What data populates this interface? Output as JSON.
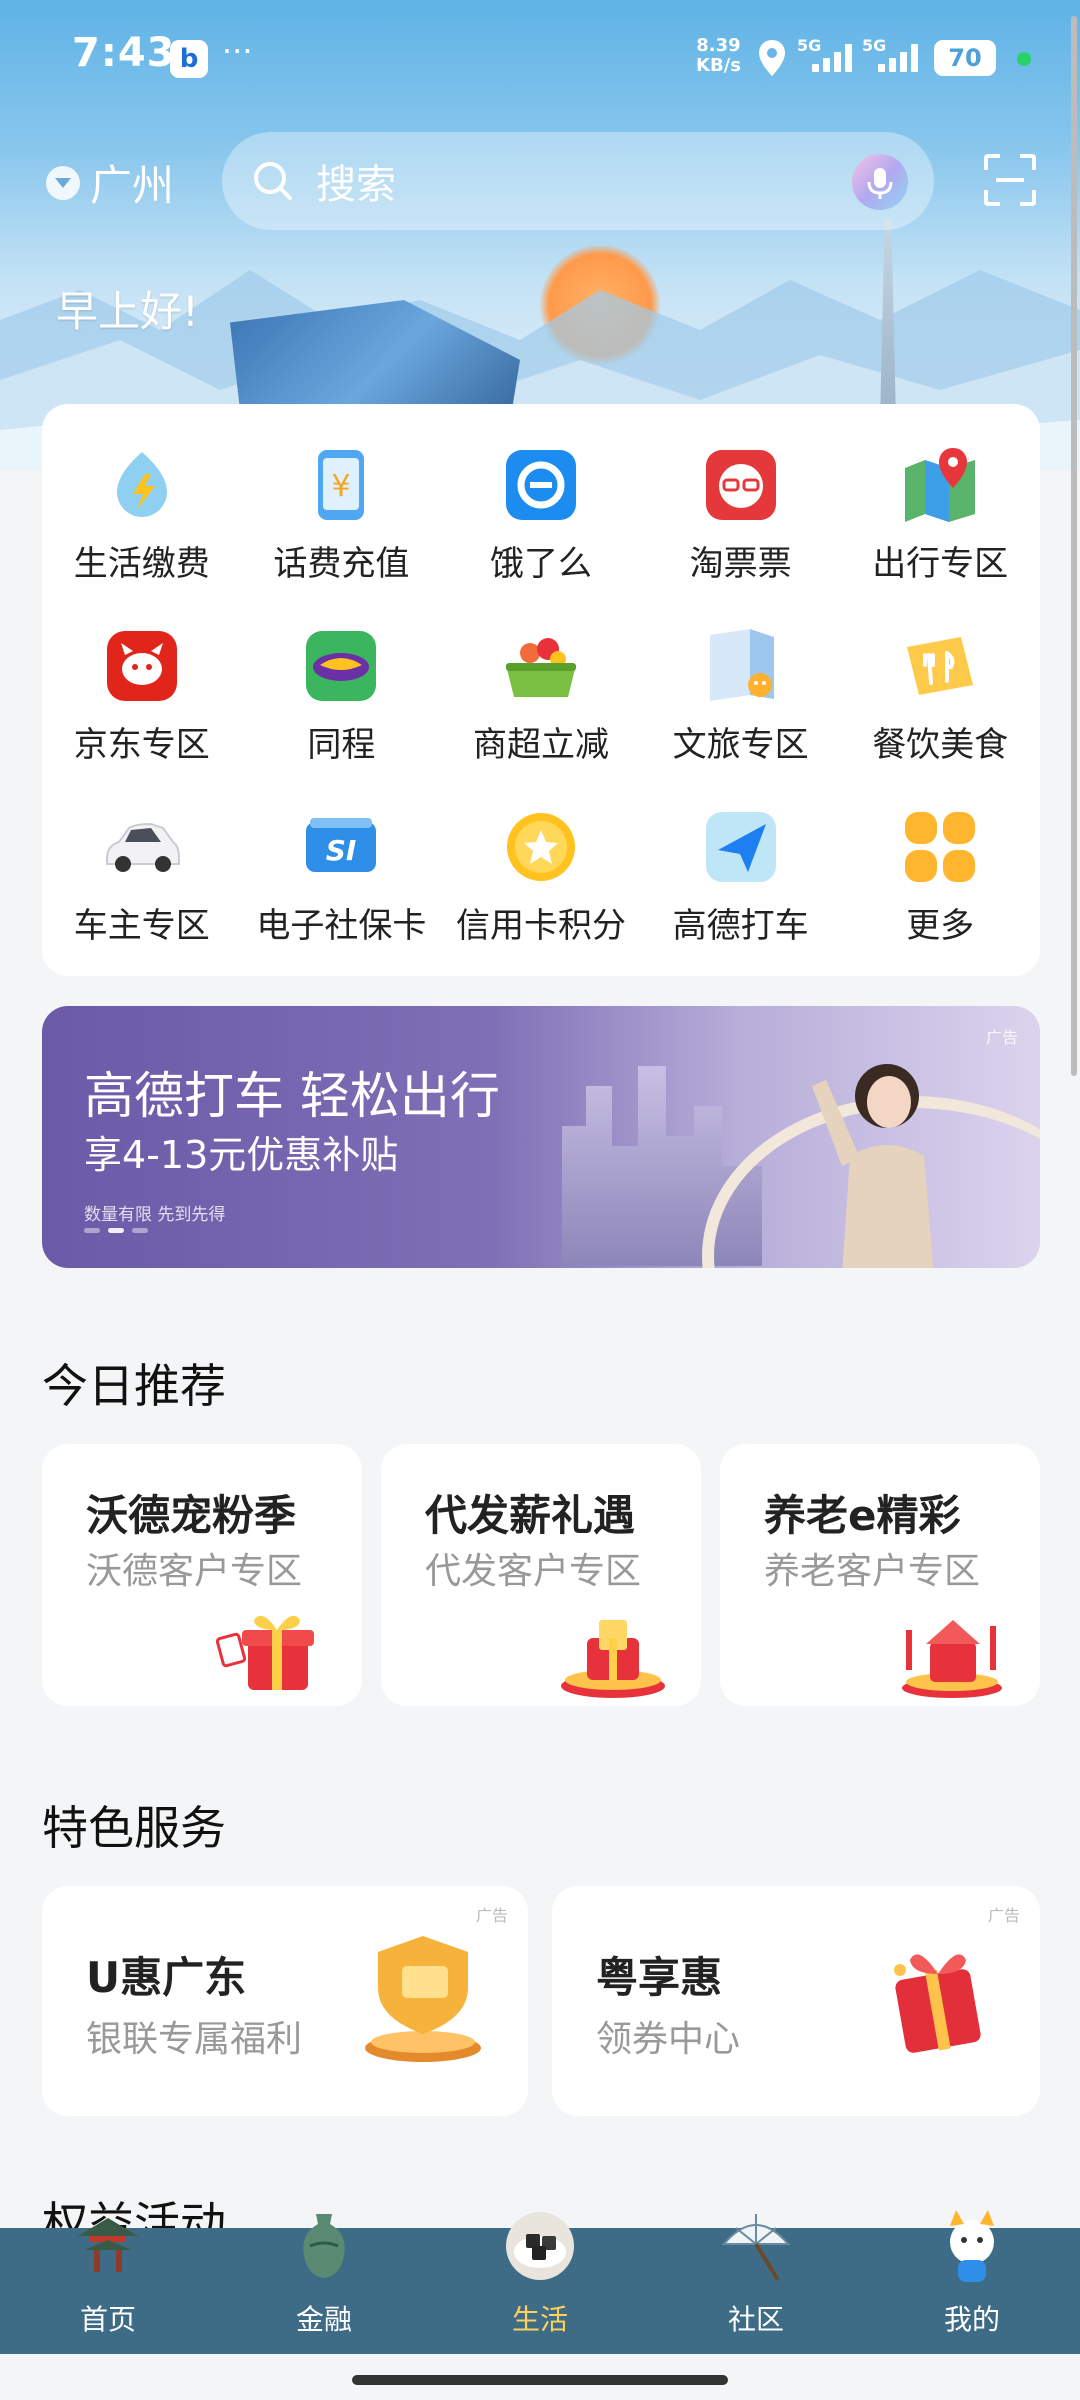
{
  "status_bar": {
    "time": "7:43",
    "net_speed_value": "8.39",
    "net_speed_unit": "KB/s",
    "signal1": "5G",
    "signal2": "5G",
    "battery": "70"
  },
  "header": {
    "city": "广州",
    "search_placeholder": "搜索",
    "greeting": "早上好!"
  },
  "services": [
    {
      "label": "生活缴费",
      "icon": "utility-bill-icon"
    },
    {
      "label": "话费充值",
      "icon": "phone-recharge-icon"
    },
    {
      "label": "饿了么",
      "icon": "eleme-icon"
    },
    {
      "label": "淘票票",
      "icon": "taopiaopiao-icon"
    },
    {
      "label": "出行专区",
      "icon": "travel-map-icon"
    },
    {
      "label": "京东专区",
      "icon": "jd-icon"
    },
    {
      "label": "同程",
      "icon": "tongcheng-icon"
    },
    {
      "label": "商超立减",
      "icon": "supermarket-basket-icon"
    },
    {
      "label": "文旅专区",
      "icon": "culture-travel-icon"
    },
    {
      "label": "餐饮美食",
      "icon": "dining-icon"
    },
    {
      "label": "车主专区",
      "icon": "car-icon"
    },
    {
      "label": "电子社保卡",
      "icon": "social-security-card-icon"
    },
    {
      "label": "信用卡积分",
      "icon": "credit-points-icon"
    },
    {
      "label": "高德打车",
      "icon": "amap-taxi-icon"
    },
    {
      "label": "更多",
      "icon": "more-grid-icon"
    }
  ],
  "banner": {
    "title": "高德打车 轻松出行",
    "subtitle": "享4-13元优惠补贴",
    "note": "数量有限 先到先得",
    "ad": "广告"
  },
  "recommend": {
    "title": "今日推荐",
    "items": [
      {
        "title": "沃德宠粉季",
        "sub": "沃德客户专区"
      },
      {
        "title": "代发薪礼遇",
        "sub": "代发客户专区"
      },
      {
        "title": "养老e精彩",
        "sub": "养老客户专区"
      }
    ]
  },
  "featured": {
    "title": "特色服务",
    "items": [
      {
        "title": "U惠广东",
        "sub": "银联专属福利",
        "ad": "广告"
      },
      {
        "title": "粤享惠",
        "sub": "领券中心",
        "ad": "广告"
      }
    ]
  },
  "next_section_title": "权益活动",
  "tabs": [
    {
      "label": "首页",
      "icon": "pavilion-icon"
    },
    {
      "label": "金融",
      "icon": "vase-icon"
    },
    {
      "label": "生活",
      "icon": "food-bowl-icon",
      "active": true
    },
    {
      "label": "社区",
      "icon": "umbrella-icon"
    },
    {
      "label": "我的",
      "icon": "mascot-icon"
    }
  ],
  "colors": {
    "tabbar": "#3e6c86",
    "active_tab": "#ffd05a",
    "hero_sky": "#5fb3e6"
  }
}
